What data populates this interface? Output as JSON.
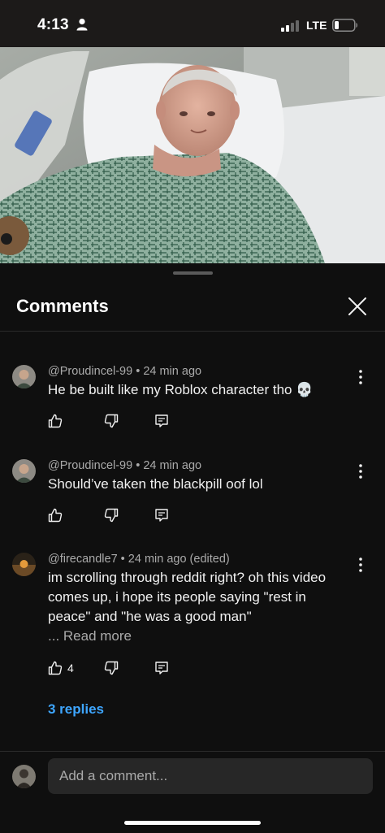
{
  "status_bar": {
    "time": "4:13",
    "network": "LTE"
  },
  "comments_panel": {
    "title": "Comments"
  },
  "comments": [
    {
      "author": "@Proudincel-99",
      "age": "24 min ago",
      "meta": "@Proudincel-99 • 24 min ago",
      "text": "He be built like my Roblox character tho 💀",
      "likes": ""
    },
    {
      "author": "@Proudincel-99",
      "age": "24 min ago",
      "meta": "@Proudincel-99 • 24 min ago",
      "text": "Should’ve taken the blackpill oof lol",
      "likes": ""
    },
    {
      "author": "@firecandle7",
      "age": "24 min ago (edited)",
      "meta": "@firecandle7 • 24 min ago (edited)",
      "text": "im scrolling through reddit right? oh this video comes up, i hope its people saying \"rest in peace\" and \"he was a good man\"",
      "read_more": "... Read more",
      "likes": "4",
      "replies": "3 replies"
    }
  ],
  "composer": {
    "placeholder": "Add a comment..."
  },
  "colors": {
    "background": "#0f0f0f",
    "accent_link": "#3ea6ff",
    "secondary_text": "#aaaaaa",
    "input_bg": "#272727"
  }
}
